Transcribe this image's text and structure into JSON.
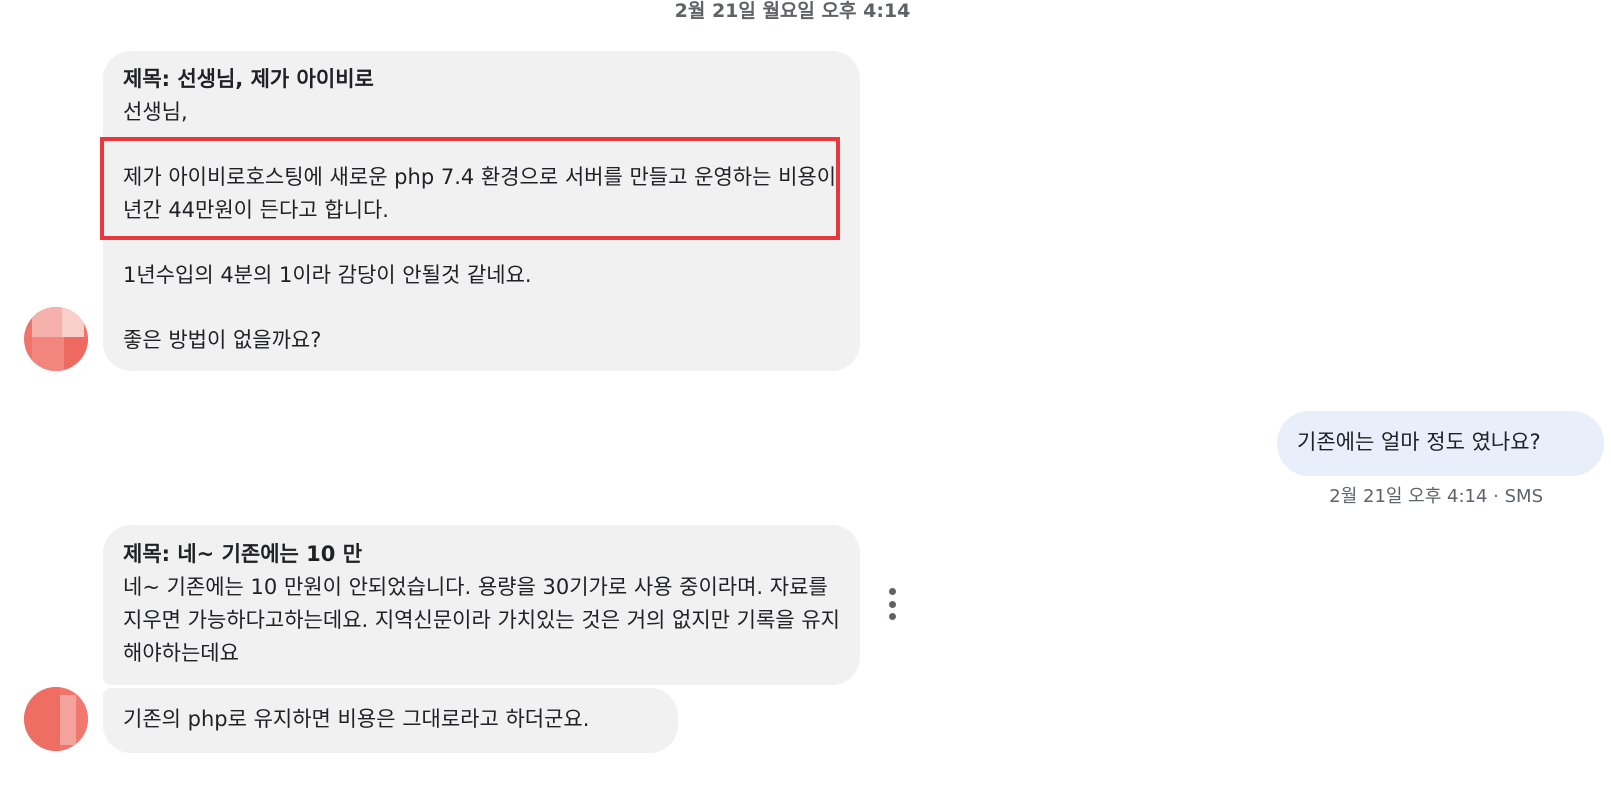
{
  "conversation": {
    "date_header": "2월 21일 월요일 오후 4:14",
    "messages": [
      {
        "subject": "제목: 선생님, 제가 아이비로",
        "greeting": "선생님,",
        "para1": "제가 아이비로호스팅에 새로운  php  7.4 환경으로 서버를 만들고 운영하는 비용이 년간 44만원이 든다고 합니다.",
        "para2": "1년수입의 4분의 1이라 감당이 안될것 같네요.",
        "para3": "좋은 방법이 없을까요?"
      },
      {
        "text": "기존에는 얼마 정도 였나요?",
        "meta": "2월 21일 오후 4:14 · SMS"
      },
      {
        "subject": "제목: 네~ 기존에는 10 만",
        "body": "네~  기존에는 10 만원이 안되었습니다.  용량을 30기가로 사용 중이라며.  자료를 지우면 가능하다고하는데요.  지역신문이라 가치있는 것은 거의 없지만 기록을 유지해야하는데요"
      },
      {
        "text": "기존의 php로 유지하면 비용은 그대로라고 하더군요."
      }
    ]
  },
  "icons": {
    "more_options": "more-vertical-icon"
  },
  "colors": {
    "incoming_bubble": "#f1f1f1",
    "outgoing_bubble": "#e8effb",
    "highlight_border": "#e8383e",
    "avatar": "#f0746a",
    "meta_text": "#5f6368"
  }
}
